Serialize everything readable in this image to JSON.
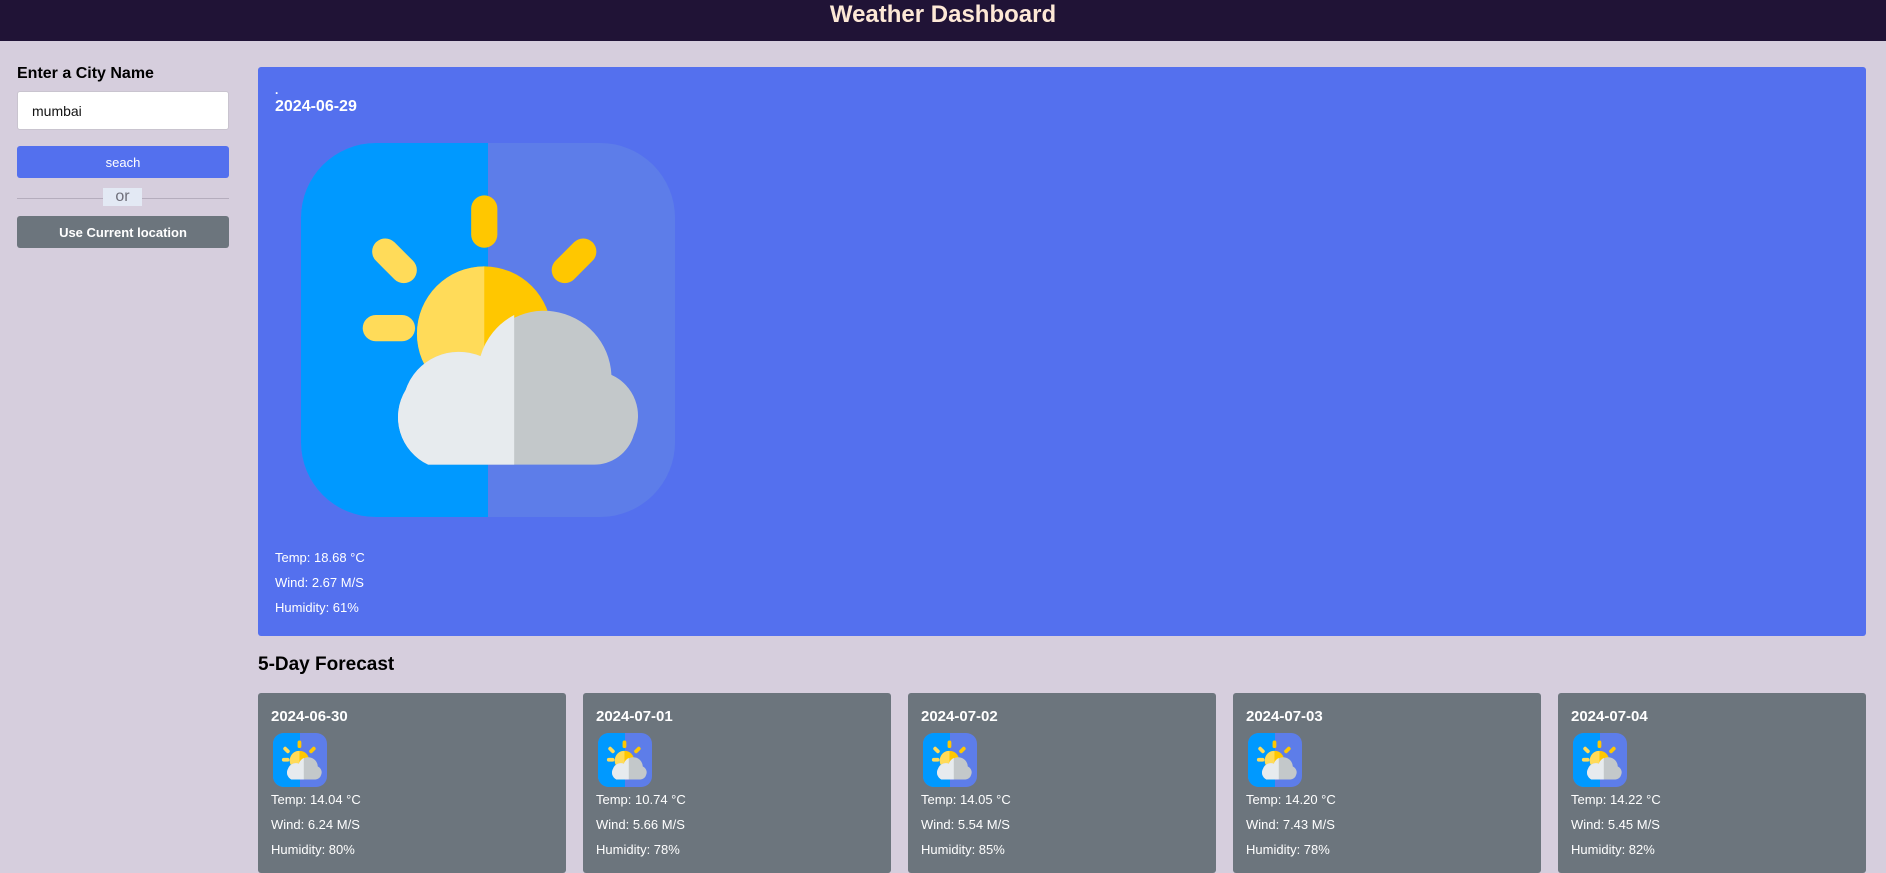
{
  "header": {
    "title": "Weather Dashboard"
  },
  "sidebar": {
    "city_label": "Enter a City Name",
    "city_input_value": "mumbai",
    "search_label": "seach",
    "or_label": "or",
    "location_label": "Use Current location"
  },
  "current": {
    "city": ".",
    "date": "2024-06-29",
    "icon": "partly-sunny-icon",
    "temp_label": "Temp: 18.68 °C",
    "wind_label": "Wind: 2.67 M/S",
    "humidity_label": "Humidity: 61%"
  },
  "forecast": {
    "title": "5-Day Forecast",
    "days": [
      {
        "date": "2024-06-30",
        "temp": "Temp: 14.04 °C",
        "wind": "Wind: 6.24 M/S",
        "humidity": "Humidity: 80%",
        "icon": "partly-sunny-icon"
      },
      {
        "date": "2024-07-01",
        "temp": "Temp: 10.74 °C",
        "wind": "Wind: 5.66 M/S",
        "humidity": "Humidity: 78%",
        "icon": "partly-sunny-icon"
      },
      {
        "date": "2024-07-02",
        "temp": "Temp: 14.05 °C",
        "wind": "Wind: 5.54 M/S",
        "humidity": "Humidity: 85%",
        "icon": "partly-sunny-icon"
      },
      {
        "date": "2024-07-03",
        "temp": "Temp: 14.20 °C",
        "wind": "Wind: 7.43 M/S",
        "humidity": "Humidity: 78%",
        "icon": "partly-sunny-icon"
      },
      {
        "date": "2024-07-04",
        "temp": "Temp: 14.22 °C",
        "wind": "Wind: 5.45 M/S",
        "humidity": "Humidity: 82%",
        "icon": "partly-sunny-icon"
      }
    ]
  },
  "colors": {
    "header_bg": "#201336",
    "page_bg": "#d6cedd",
    "accent": "#5470ee",
    "card_bg": "#6c757d"
  }
}
